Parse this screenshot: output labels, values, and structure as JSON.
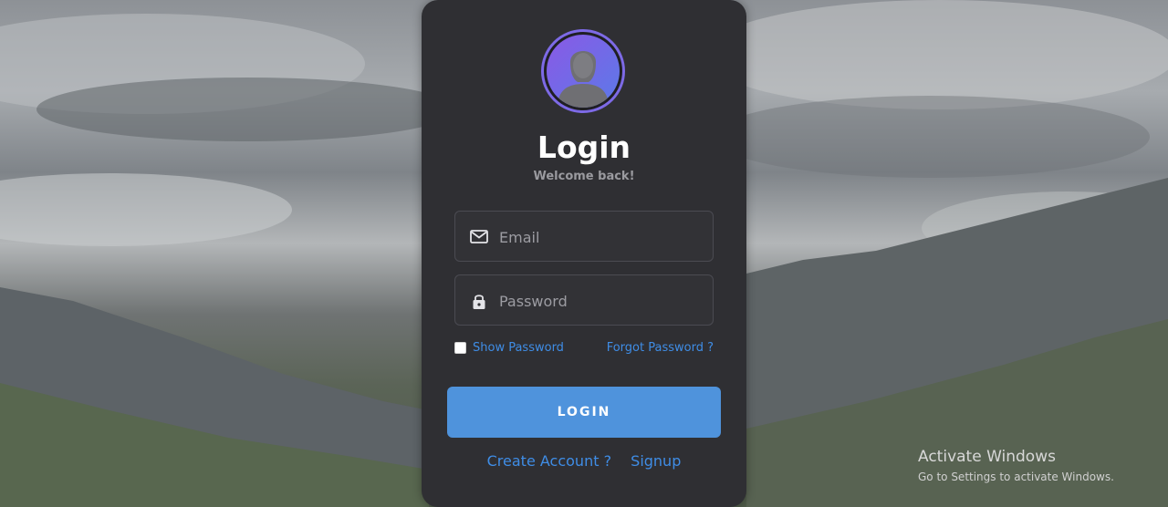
{
  "login": {
    "title": "Login",
    "subtitle": "Welcome back!",
    "email_placeholder": "Email",
    "password_placeholder": "Password",
    "show_password_label": "Show Password",
    "forgot_password_label": "Forgot Password ?",
    "login_button_label": "LOGIN",
    "create_account_label": "Create Account ?",
    "signup_label": "Signup",
    "icons": {
      "avatar": "user-avatar-icon",
      "email": "mail-icon",
      "password": "lock-icon"
    }
  },
  "watermark": {
    "title": "Activate Windows",
    "subtitle": "Go to Settings to activate Windows."
  },
  "colors": {
    "card_background": "#2f2f33",
    "accent_blue": "#4f93dc",
    "link_blue": "#3f8de6",
    "avatar_gradient_start": "#8a59e6",
    "avatar_gradient_end": "#5b7ae8"
  }
}
